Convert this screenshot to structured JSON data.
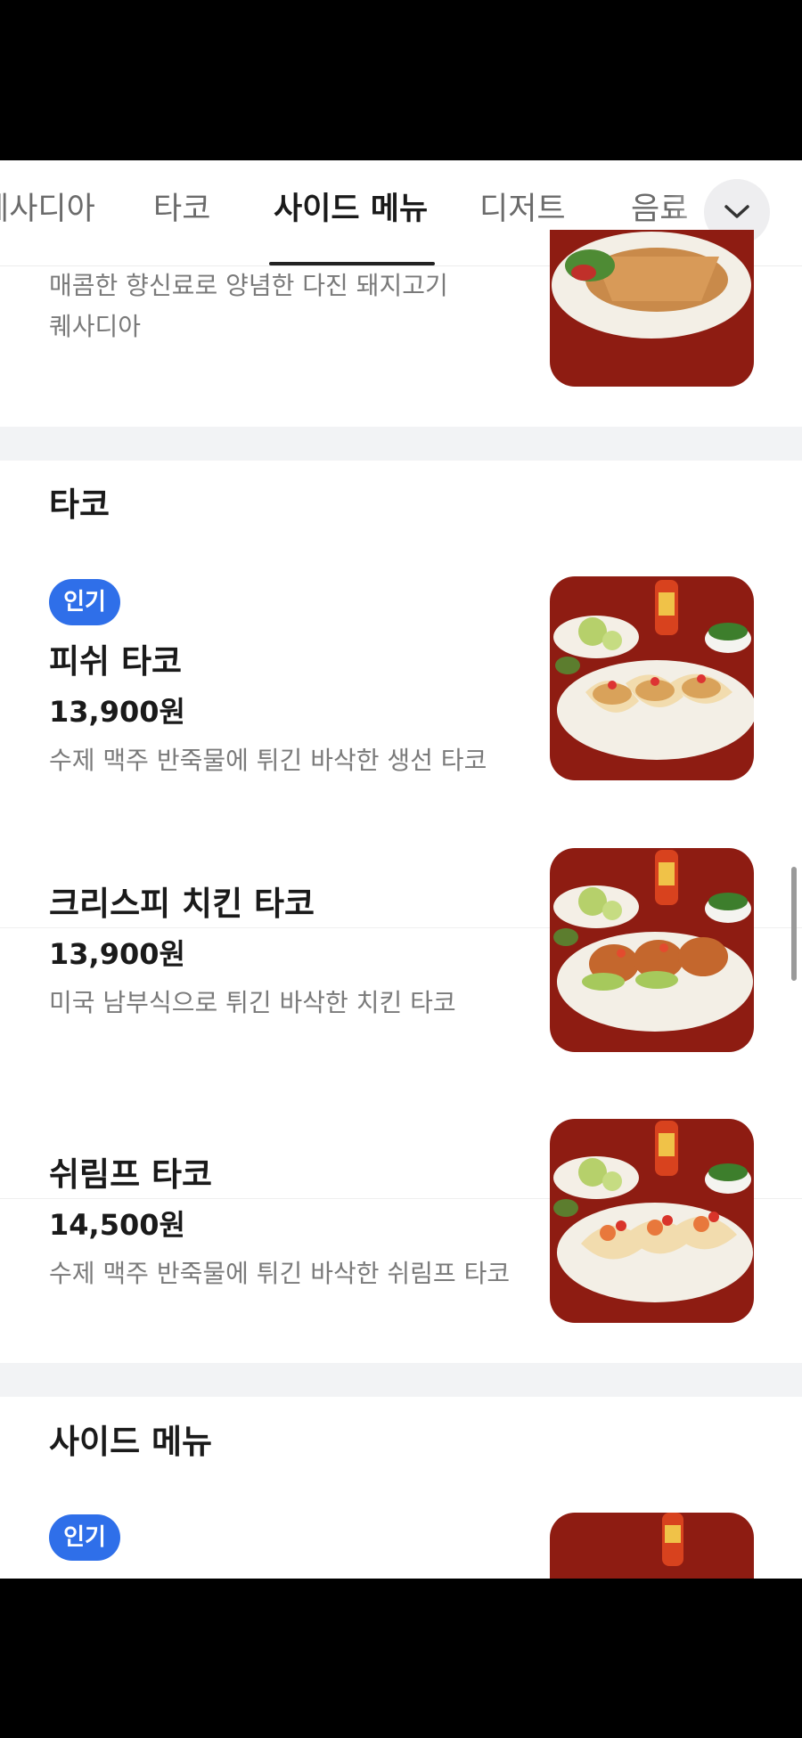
{
  "tabs": [
    {
      "label": "퀘사디아"
    },
    {
      "label": "타코"
    },
    {
      "label": "사이드 메뉴"
    },
    {
      "label": "디저트"
    },
    {
      "label": "음료"
    }
  ],
  "active_tab": "사이드 메뉴",
  "prev_item": {
    "desc_line1": "매콤한 향신료로 양념한 다진 돼지고기",
    "desc_line2": "퀘사디아",
    "image": "quesadilla-photo"
  },
  "sections": [
    {
      "title": "타코",
      "items": [
        {
          "badge": "인기",
          "name": "피쉬 타코",
          "price": "13,900원",
          "desc": "수제 맥주 반죽물에 튀긴 바삭한 생선 타코",
          "image": "fish-taco-photo"
        },
        {
          "badge": "",
          "name": "크리스피 치킨 타코",
          "price": "13,900원",
          "desc": "미국 남부식으로 튀긴 바삭한 치킨 타코",
          "image": "chicken-taco-photo"
        },
        {
          "badge": "",
          "name": "쉬림프 타코",
          "price": "14,500원",
          "desc": "수제 맥주 반죽물에 튀긴 바삭한 쉬림프 타코",
          "image": "shrimp-taco-photo"
        }
      ]
    },
    {
      "title": "사이드 메뉴",
      "items": [
        {
          "badge": "인기",
          "image": "side-menu-photo"
        }
      ]
    }
  ],
  "icons": {
    "expand": "chevron-down-icon"
  },
  "colors": {
    "badge": "#2f6fe9",
    "separator": "#f2f3f5",
    "plate_bg": "#8e1c12"
  }
}
